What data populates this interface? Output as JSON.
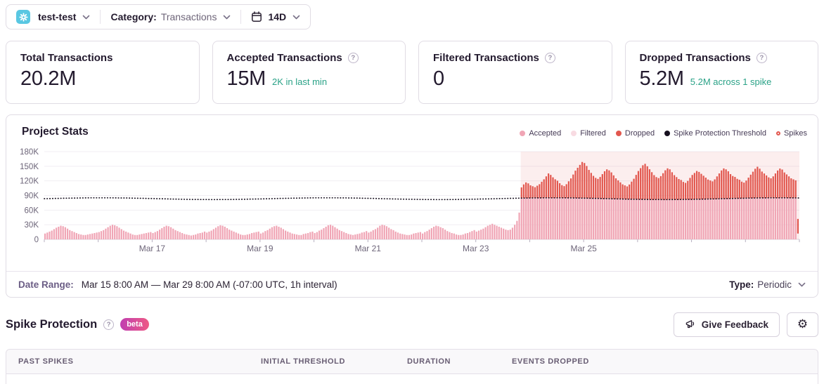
{
  "colors": {
    "accent_teal": "#2aa287",
    "accepted_pink": "#f0a5b5",
    "filtered_pink": "#f8dbe2",
    "dropped_red": "#e2574e",
    "threshold_dark": "#17101f",
    "spike_shade": "rgba(230,90,85,0.10)",
    "project_icon_cyan": "#59c7e2",
    "beta_gradient": [
      "#c03fb1",
      "#ee5a85"
    ]
  },
  "topbar": {
    "project_name": "test-test",
    "category_label": "Category:",
    "category_value": "Transactions",
    "period_value": "14D"
  },
  "cards": [
    {
      "title": "Total Transactions",
      "value": "20.2M",
      "subtext": ""
    },
    {
      "title": "Accepted Transactions",
      "value": "15M",
      "subtext": "2K in last min"
    },
    {
      "title": "Filtered Transactions",
      "value": "0",
      "subtext": ""
    },
    {
      "title": "Dropped Transactions",
      "value": "5.2M",
      "subtext": "5.2M across 1 spike"
    }
  ],
  "chart": {
    "title": "Project Stats",
    "legend": [
      {
        "label": "Accepted",
        "color": "#f0a5b5",
        "type": "dot"
      },
      {
        "label": "Filtered",
        "color": "#f8dbe2",
        "type": "dot"
      },
      {
        "label": "Dropped",
        "color": "#e2574e",
        "type": "dot"
      },
      {
        "label": "Spike Protection Threshold",
        "color": "#17101f",
        "type": "dot"
      },
      {
        "label": "Spikes",
        "color": "#e2574e",
        "type": "ring"
      }
    ]
  },
  "chart_data": {
    "type": "bar",
    "stacked": true,
    "title": "Project Stats",
    "x_start": "Mar 15 8:00 AM",
    "x_end": "Mar 29 8:00 AM",
    "interval_hours": 1,
    "n_points": 336,
    "ylim_k": [
      0,
      180
    ],
    "y_tick_labels": [
      "180K",
      "150K",
      "120K",
      "90K",
      "60K",
      "30K",
      "0"
    ],
    "x_tick_labels": [
      "Mar 17",
      "Mar 19",
      "Mar 21",
      "Mar 23",
      "Mar 25"
    ],
    "x_tick_indices": [
      48,
      96,
      144,
      192,
      240
    ],
    "day_tick_every": 24,
    "threshold": {
      "name": "Spike Protection Threshold",
      "level_k": 83.5,
      "style": "dotted"
    },
    "spike_region": {
      "start_index": 212,
      "end_index": 336,
      "spike_count": 1,
      "dropped_total": "5.2M"
    },
    "series_accepted": {
      "name": "Accepted",
      "color": "#f0a5b5",
      "prespike_values_k": [
        12,
        14,
        16,
        18,
        21,
        24,
        26,
        28,
        27,
        25,
        22,
        19,
        17,
        15,
        13,
        11,
        10,
        9,
        9,
        10,
        11,
        12,
        13,
        14,
        15,
        17,
        19,
        22,
        25,
        28,
        30,
        29,
        27,
        24,
        21,
        18,
        16,
        14,
        12,
        10,
        9,
        9,
        10,
        11,
        12,
        13,
        14,
        15,
        13,
        15,
        17,
        20,
        23,
        26,
        28,
        27,
        25,
        22,
        19,
        17,
        15,
        13,
        11,
        10,
        9,
        8,
        9,
        10,
        12,
        13,
        14,
        16,
        14,
        16,
        18,
        21,
        24,
        27,
        29,
        28,
        26,
        23,
        20,
        18,
        16,
        14,
        12,
        10,
        9,
        9,
        10,
        11,
        13,
        14,
        15,
        16,
        12,
        14,
        17,
        19,
        22,
        25,
        27,
        28,
        26,
        24,
        21,
        18,
        16,
        14,
        12,
        11,
        10,
        9,
        9,
        11,
        12,
        13,
        15,
        16,
        13,
        15,
        18,
        20,
        23,
        26,
        29,
        30,
        28,
        25,
        22,
        19,
        17,
        15,
        13,
        11,
        10,
        9,
        10,
        11,
        12,
        14,
        15,
        17,
        14,
        16,
        19,
        21,
        24,
        28,
        30,
        29,
        27,
        24,
        21,
        19,
        16,
        14,
        12,
        11,
        10,
        9,
        9,
        10,
        12,
        13,
        14,
        15,
        12,
        15,
        17,
        20,
        23,
        26,
        28,
        27,
        25,
        23,
        20,
        17,
        15,
        13,
        12,
        10,
        9,
        9,
        10,
        12,
        13,
        15,
        17,
        19,
        16,
        18,
        20,
        22,
        25,
        28,
        30,
        32,
        30,
        28,
        26,
        24,
        22,
        20,
        19,
        20,
        24,
        30,
        38,
        55
      ],
      "spike_level_k": 83.5
    },
    "series_filtered": {
      "name": "Filtered",
      "color": "#f8dbe2",
      "constant_k": 0
    },
    "series_dropped": {
      "name": "Dropped",
      "color": "#e2574e",
      "start_index": 212,
      "values_k": [
        22,
        28,
        32,
        30,
        26,
        24,
        22,
        25,
        28,
        33,
        38,
        44,
        50,
        47,
        42,
        38,
        35,
        30,
        26,
        24,
        28,
        34,
        40,
        48,
        56,
        62,
        68,
        74,
        72,
        66,
        58,
        52,
        46,
        42,
        40,
        44,
        50,
        56,
        60,
        58,
        54,
        48,
        42,
        38,
        34,
        30,
        28,
        26,
        30,
        36,
        42,
        50,
        58,
        64,
        70,
        73,
        68,
        62,
        56,
        50,
        46,
        44,
        48,
        54,
        60,
        64,
        62,
        56,
        50,
        46,
        42,
        40,
        36,
        34,
        38,
        44,
        50,
        54,
        58,
        56,
        52,
        48,
        44,
        40,
        38,
        36,
        40,
        46,
        52,
        58,
        62,
        60,
        56,
        50,
        46,
        44,
        40,
        38,
        34,
        32,
        36,
        42,
        48,
        54,
        60,
        64,
        60,
        54,
        50,
        46,
        42,
        40,
        44,
        50,
        56,
        60,
        58,
        52,
        48,
        44,
        40,
        38,
        36
      ]
    },
    "last_bar": {
      "index": 335,
      "from_k": 12,
      "to_k": 42
    }
  },
  "date_range_row": {
    "label": "Date Range:",
    "value": "Mar 15 8:00 AM — Mar 29 8:00 AM (-07:00 UTC, 1h interval)",
    "type_label": "Type:",
    "type_value": "Periodic"
  },
  "spike_protection": {
    "title": "Spike Protection",
    "badge": "beta",
    "feedback_label": "Give Feedback",
    "gear_icon": "⚙"
  },
  "table": {
    "headers": [
      "Past Spikes",
      "Initial Threshold",
      "Duration",
      "Events Dropped"
    ]
  }
}
